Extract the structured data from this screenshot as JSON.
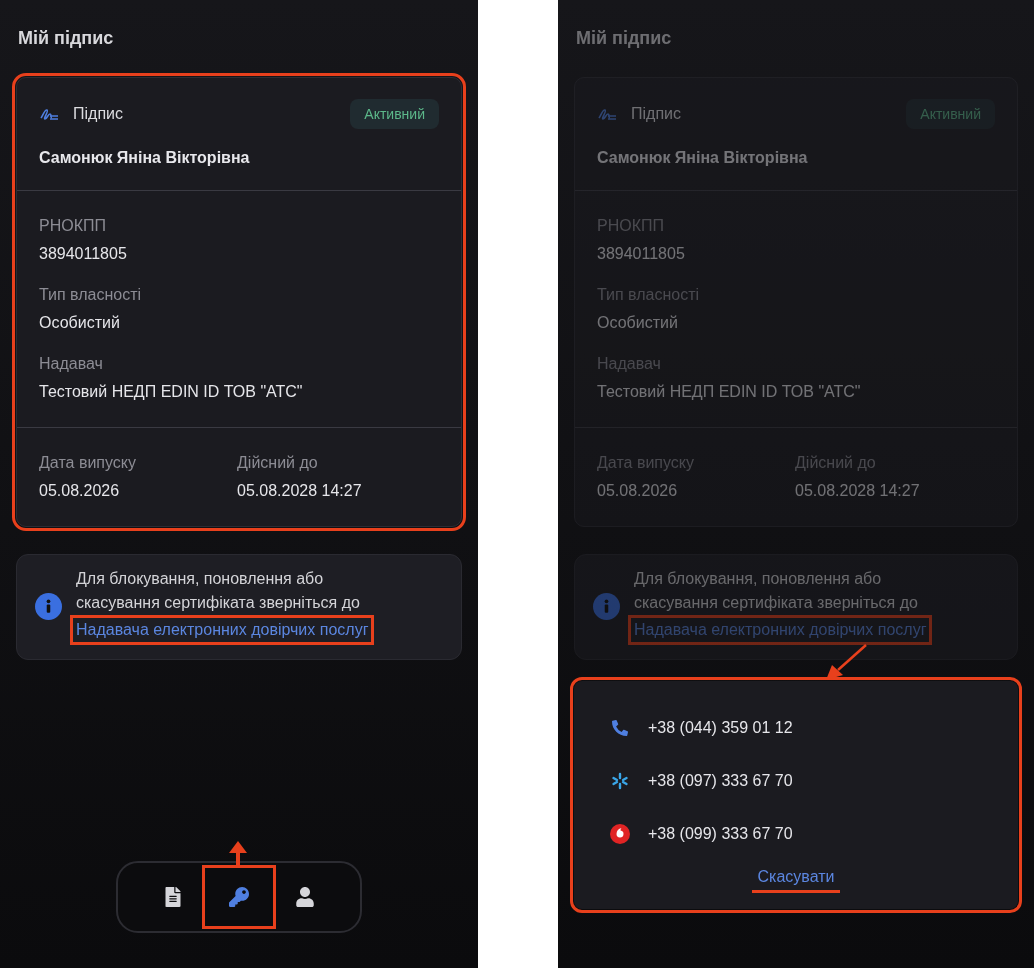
{
  "screens": [
    {
      "title": "Мій підпис",
      "dimmed": false,
      "nav_arrow": true,
      "sheet_arrow": false,
      "card": {
        "highlighted": true,
        "type_label": "Підпис",
        "status": "Активний",
        "owner": "Самонюк Яніна Вікторівна",
        "fields": [
          {
            "label": "РНОКПП",
            "value": "3894011805"
          },
          {
            "label": "Тип власності",
            "value": "Особистий"
          },
          {
            "label": "Надавач",
            "value": "Тестовий НЕДП EDIN ID ТОВ \"АТС\""
          }
        ],
        "dates": [
          {
            "label": "Дата випуску",
            "value": "05.08.2026"
          },
          {
            "label": "Дійсний до",
            "value": "05.08.2028 14:27"
          }
        ]
      },
      "info": {
        "text": "Для блокування, поновлення або скасування сертифіката зверніться до",
        "link": "Надавача електронних довірчих послуг",
        "link_highlighted": true
      },
      "nav": [
        {
          "kind": "document",
          "selected": false,
          "highlighted": false
        },
        {
          "kind": "key",
          "selected": true,
          "highlighted": true
        },
        {
          "kind": "person",
          "selected": false,
          "highlighted": false
        }
      ]
    },
    {
      "title": "Мій підпис",
      "dimmed": true,
      "nav_arrow": false,
      "sheet_arrow": true,
      "card": {
        "highlighted": false,
        "type_label": "Підпис",
        "status": "Активний",
        "owner": "Самонюк Яніна Вікторівна",
        "fields": [
          {
            "label": "РНОКПП",
            "value": "3894011805"
          },
          {
            "label": "Тип власності",
            "value": "Особистий"
          },
          {
            "label": "Надавач",
            "value": "Тестовий НЕДП EDIN ID ТОВ \"АТС\""
          }
        ],
        "dates": [
          {
            "label": "Дата випуску",
            "value": "05.08.2026"
          },
          {
            "label": "Дійсний до",
            "value": "05.08.2028 14:27"
          }
        ]
      },
      "info": {
        "text": "Для блокування, поновлення або скасування сертифіката зверніться до",
        "link": "Надавача електронних довірчих послуг",
        "link_highlighted": true
      },
      "sheet": {
        "highlighted": true,
        "contacts": [
          {
            "kind": "landline",
            "number": "+38 (044) 359 01 12"
          },
          {
            "kind": "kyivstar",
            "number": "+38 (097) 333 67 70"
          },
          {
            "kind": "vodafone",
            "number": "+38 (099) 333 67 70"
          }
        ],
        "cancel": "Скасувати",
        "cancel_underlined": true
      }
    }
  ]
}
